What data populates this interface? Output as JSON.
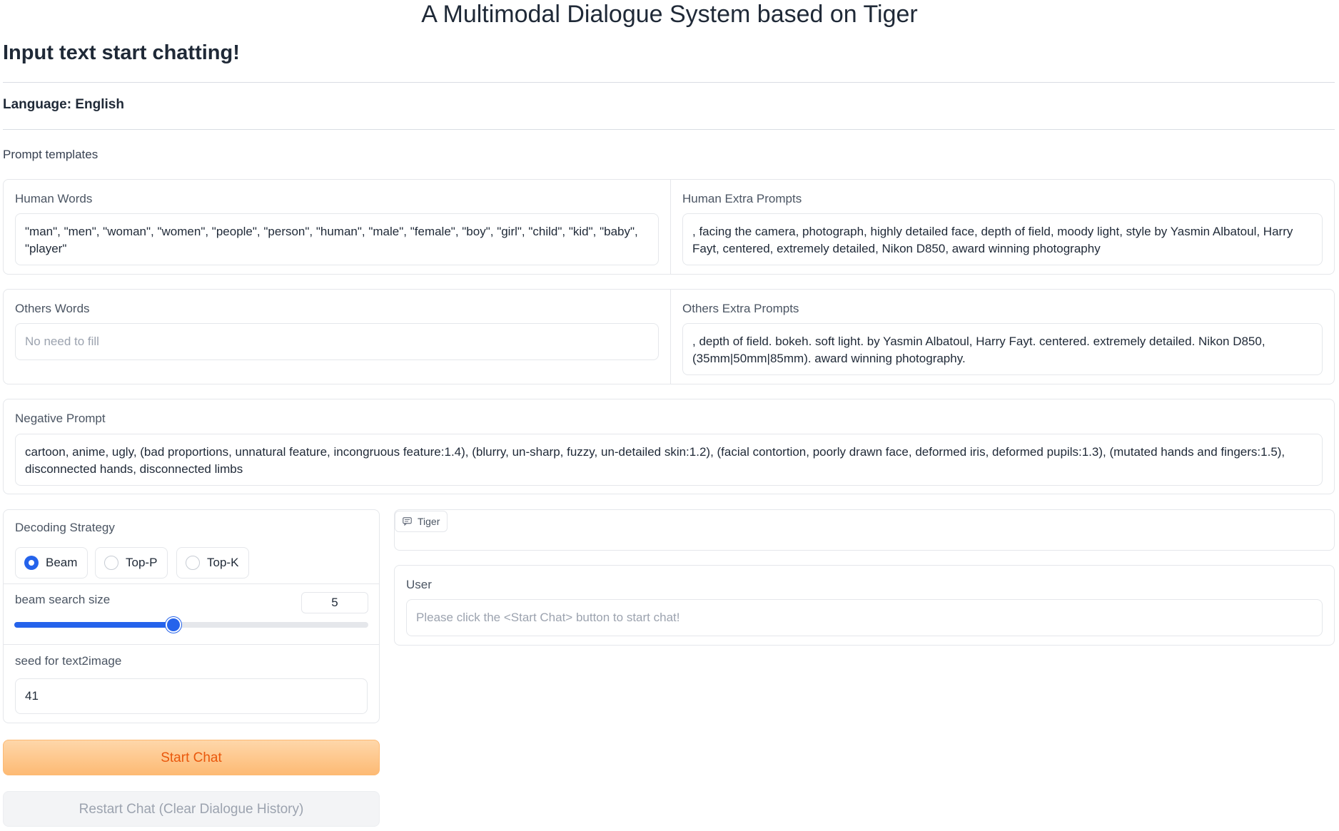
{
  "header": {
    "title": "A Multimodal Dialogue System based on Tiger",
    "subtitle": "Input text start chatting!",
    "language": "Language: English"
  },
  "prompt_templates": {
    "label": "Prompt templates",
    "human_words": {
      "label": "Human Words",
      "value": "\"man\", \"men\", \"woman\", \"women\", \"people\", \"person\", \"human\", \"male\", \"female\", \"boy\", \"girl\", \"child\", \"kid\", \"baby\", \"player\""
    },
    "human_extra_prompts": {
      "label": "Human Extra Prompts",
      "value": ", facing the camera, photograph, highly detailed face, depth of field, moody light, style by Yasmin Albatoul, Harry Fayt, centered, extremely detailed, Nikon D850, award winning photography"
    },
    "others_words": {
      "label": "Others Words",
      "placeholder": "No need to fill"
    },
    "others_extra_prompts": {
      "label": "Others Extra Prompts",
      "value": ", depth of field. bokeh. soft light. by Yasmin Albatoul, Harry Fayt. centered. extremely detailed. Nikon D850, (35mm|50mm|85mm). award winning photography."
    },
    "negative_prompt": {
      "label": "Negative Prompt",
      "value": "cartoon, anime, ugly, (bad proportions, unnatural feature, incongruous feature:1.4), (blurry, un-sharp, fuzzy, un-detailed skin:1.2), (facial contortion, poorly drawn face, deformed iris, deformed pupils:1.3), (mutated hands and fingers:1.5), disconnected hands, disconnected limbs"
    }
  },
  "settings": {
    "decoding_label": "Decoding Strategy",
    "decoding_options": [
      "Beam",
      "Top-P",
      "Top-K"
    ],
    "decoding_selected": "Beam",
    "beam_label": "beam search size",
    "beam_value": "5",
    "beam_fraction": 0.45,
    "seed_label": "seed for text2image",
    "seed_value": "41"
  },
  "buttons": {
    "start": "Start Chat",
    "restart": "Restart Chat (Clear Dialogue History)"
  },
  "chat": {
    "bot_label": "Tiger",
    "user_label": "User",
    "user_placeholder": "Please click the <Start Chat> button to start chat!"
  },
  "colors": {
    "accent": "#2563eb",
    "primary_button_text": "#ea580c",
    "primary_button_bg": "#fdba74"
  }
}
